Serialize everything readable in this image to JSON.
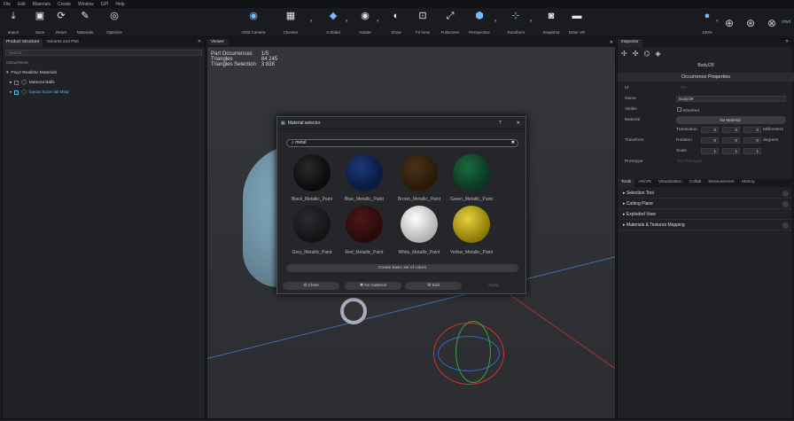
{
  "menu": [
    "File",
    "Edit",
    "Materials",
    "Create",
    "Window",
    "GPI",
    "Help"
  ],
  "toolbar": {
    "import": "Import",
    "save": "Save",
    "reset": "Reset",
    "materials": "Materials",
    "optimize": "Optimize",
    "orbit_camera": "Orbit Camera",
    "checker": "Checker",
    "two_sided": "2-Sided",
    "isolate": "Isolate",
    "show": "Show",
    "fit_view": "Fit View",
    "fullscreen": "Fullscreen",
    "perspective": "Perspective",
    "transform": "Transform",
    "snapshot": "Snapshot",
    "enter_vr": "Enter VR",
    "zoom": "100%",
    "user": "xfwd"
  },
  "left": {
    "tab1": "Product Structure",
    "tab2": "Variants and PMI",
    "search_placeholder": "Search...",
    "occurrence_label": "Occurrence",
    "root": "Pixyz Realistic Materials",
    "item1": "Material Balls",
    "item2": "toyota Scion xB Mixp"
  },
  "viewer": {
    "tab": "Viewer",
    "stat_labels": [
      "Part Occurrences",
      "Triangles",
      "Triangles Selection"
    ],
    "stat_values": [
      "1/5",
      "84 245",
      "3 838"
    ]
  },
  "dialog": {
    "title": "Material selector",
    "help": "?",
    "close": "✕",
    "search": "metal",
    "materials": [
      {
        "name": "Black_Metallic_Paint",
        "color": "#0b0b0c"
      },
      {
        "name": "Blue_Metallic_Paint",
        "color": "#0a1a40"
      },
      {
        "name": "Brown_Metallic_Paint",
        "color": "#2a1a0a"
      },
      {
        "name": "Green_Metallic_Paint",
        "color": "#0a3a22"
      },
      {
        "name": "Grey_Metallic_Paint",
        "color": "#131416"
      },
      {
        "name": "Red_Metallic_Paint",
        "color": "#2a0a0a"
      },
      {
        "name": "White_Metallic_Paint",
        "color": "#d8d8d8"
      },
      {
        "name": "Yellow_Metallic_Paint",
        "color": "#b8a000"
      }
    ],
    "create_basic": "Create basic set of colors",
    "close_btn": "Close",
    "no_material": "No material",
    "edit": "Edit",
    "apply": "Apply"
  },
  "inspector": {
    "tab": "Inspector",
    "object_name": "Body/28",
    "section": "Occurrence Properties",
    "id_label": "Id",
    "id_value": "482",
    "name_label": "Name",
    "name_value": "Body/28",
    "visible_label": "Visible",
    "inherited": "Inherited",
    "material_label": "Material",
    "material_value": "No Material",
    "transform_label": "Transform",
    "translation": "Translation",
    "rotation": "Rotation",
    "scale": "Scale",
    "millimeters": "Millimeters",
    "degrees": "degrees",
    "t_vals": [
      "0",
      "0",
      "0"
    ],
    "r_vals": [
      "0",
      "0",
      "0"
    ],
    "s_vals": [
      "1",
      "1",
      "1"
    ],
    "prototype_label": "Prototype",
    "prototype_value": "No Prototype",
    "tabs": [
      "Tools",
      "AR/VR",
      "Visualization",
      "Collab",
      "Measurement",
      "History"
    ],
    "sections": [
      "Selection Tool",
      "Cutting Plane",
      "Exploded View",
      "Materials & Textures Mapping"
    ]
  }
}
